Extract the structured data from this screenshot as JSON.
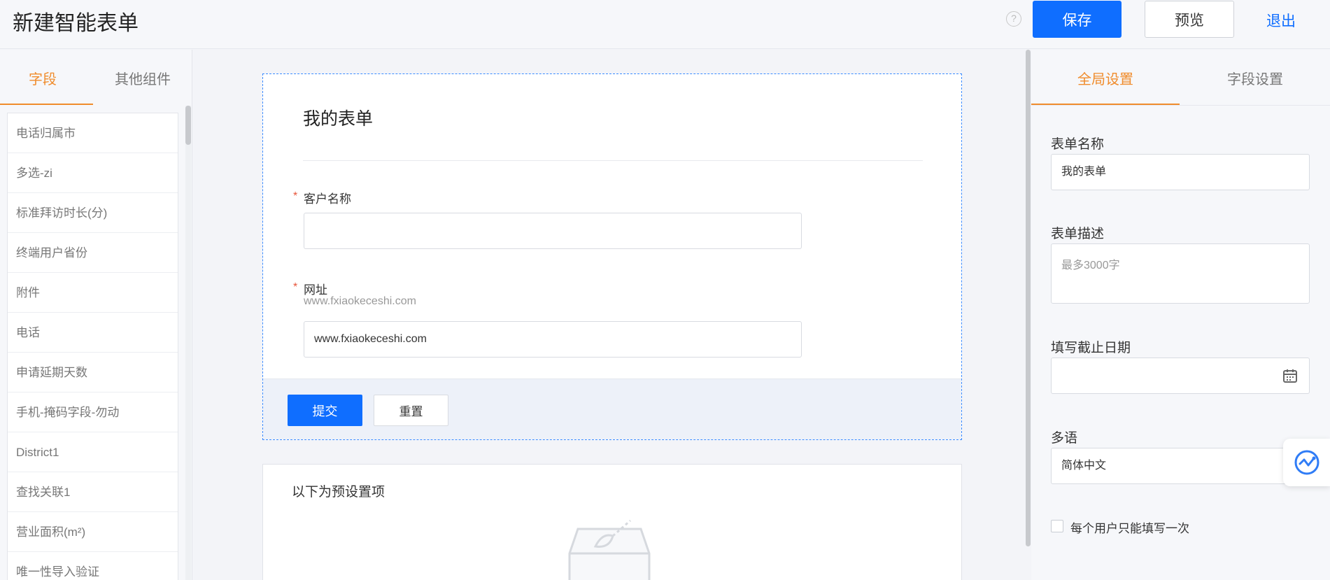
{
  "header": {
    "title": "新建智能表单",
    "help_glyph": "?",
    "save_label": "保存",
    "preview_label": "预览",
    "exit_label": "退出"
  },
  "left_panel": {
    "tabs": [
      {
        "label": "字段",
        "active": true
      },
      {
        "label": "其他组件",
        "active": false
      }
    ],
    "fields": [
      "电话归属市",
      "多选-zi",
      "标准拜访时长(分)",
      "终端用户省份",
      "附件",
      "电话",
      "申请延期天数",
      "手机-掩码字段-勿动",
      "District1",
      "查找关联1",
      "营业面积(m²)",
      "唯一性导入验证"
    ]
  },
  "form": {
    "title": "我的表单",
    "fields": [
      {
        "label": "客户名称",
        "required": true,
        "help": "",
        "value": ""
      },
      {
        "label": "网址",
        "required": true,
        "help": "www.fxiaokeceshi.com",
        "value": "www.fxiaokeceshi.com"
      }
    ],
    "required_mark": "*",
    "submit_label": "提交",
    "reset_label": "重置"
  },
  "preset": {
    "title": "以下为预设置项"
  },
  "right_panel": {
    "tabs": [
      {
        "label": "全局设置",
        "active": true
      },
      {
        "label": "字段设置",
        "active": false
      }
    ],
    "form_name_label": "表单名称",
    "form_name_value": "我的表单",
    "form_desc_label": "表单描述",
    "form_desc_placeholder": "最多3000字",
    "deadline_label": "填写截止日期",
    "language_label": "多语",
    "language_value": "简体中文",
    "once_per_user_label": "每个用户只能填写一次",
    "once_per_user_checked": false
  },
  "colors": {
    "primary": "#0f6eff",
    "accent": "#f08c2c",
    "required": "#e8553a"
  }
}
